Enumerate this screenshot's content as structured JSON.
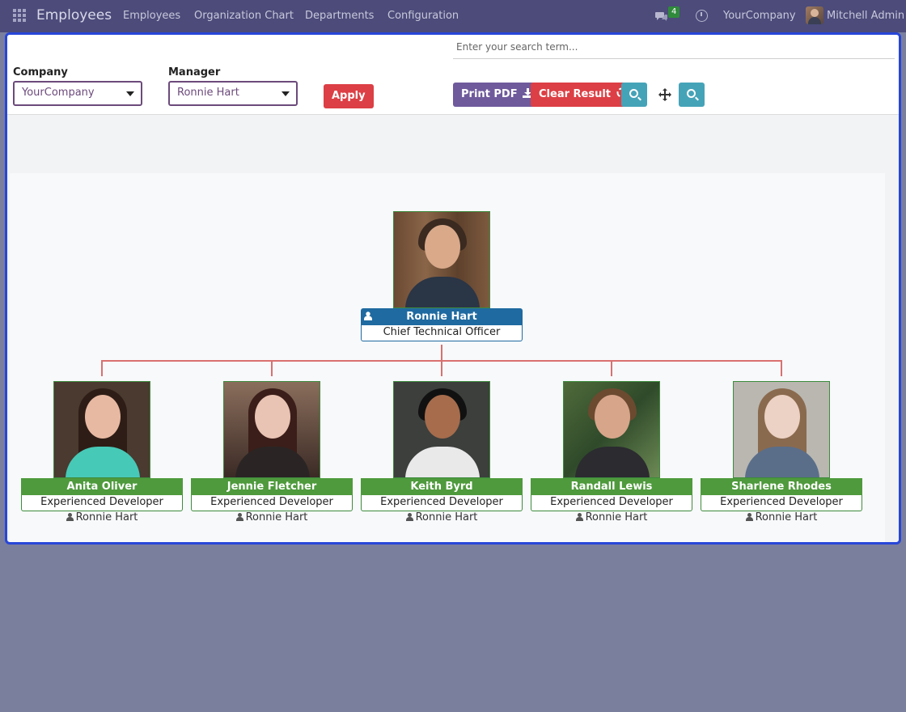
{
  "navbar": {
    "app_title": "Employees",
    "menu": [
      "Employees",
      "Organization Chart",
      "Departments",
      "Configuration"
    ],
    "chat_badge": "4",
    "company": "YourCompany",
    "user": "Mitchell Admin"
  },
  "filters": {
    "company_label": "Company",
    "company_value": "YourCompany",
    "manager_label": "Manager",
    "manager_value": "Ronnie Hart",
    "apply_label": "Apply",
    "search_placeholder": "Enter your search term..."
  },
  "toolbar": {
    "print_pdf_label": "Print PDF",
    "clear_result_label": "Clear Result",
    "print_color": "#6f5a9c",
    "clear_color": "#dc3f45",
    "tool_color": "#45a3b8"
  },
  "org": {
    "root": {
      "name": "Ronnie Hart",
      "title": "Chief Technical Officer",
      "header_color": "#1f6aa0"
    },
    "children_header_color": "#4e9a3c",
    "children": [
      {
        "name": "Anita Oliver",
        "title": "Experienced Developer",
        "manager": "Ronnie Hart"
      },
      {
        "name": "Jennie Fletcher",
        "title": "Experienced Developer",
        "manager": "Ronnie Hart"
      },
      {
        "name": "Keith Byrd",
        "title": "Experienced Developer",
        "manager": "Ronnie Hart"
      },
      {
        "name": "Randall Lewis",
        "title": "Experienced Developer",
        "manager": "Ronnie Hart"
      },
      {
        "name": "Sharlene Rhodes",
        "title": "Experienced Developer",
        "manager": "Ronnie Hart"
      }
    ]
  }
}
